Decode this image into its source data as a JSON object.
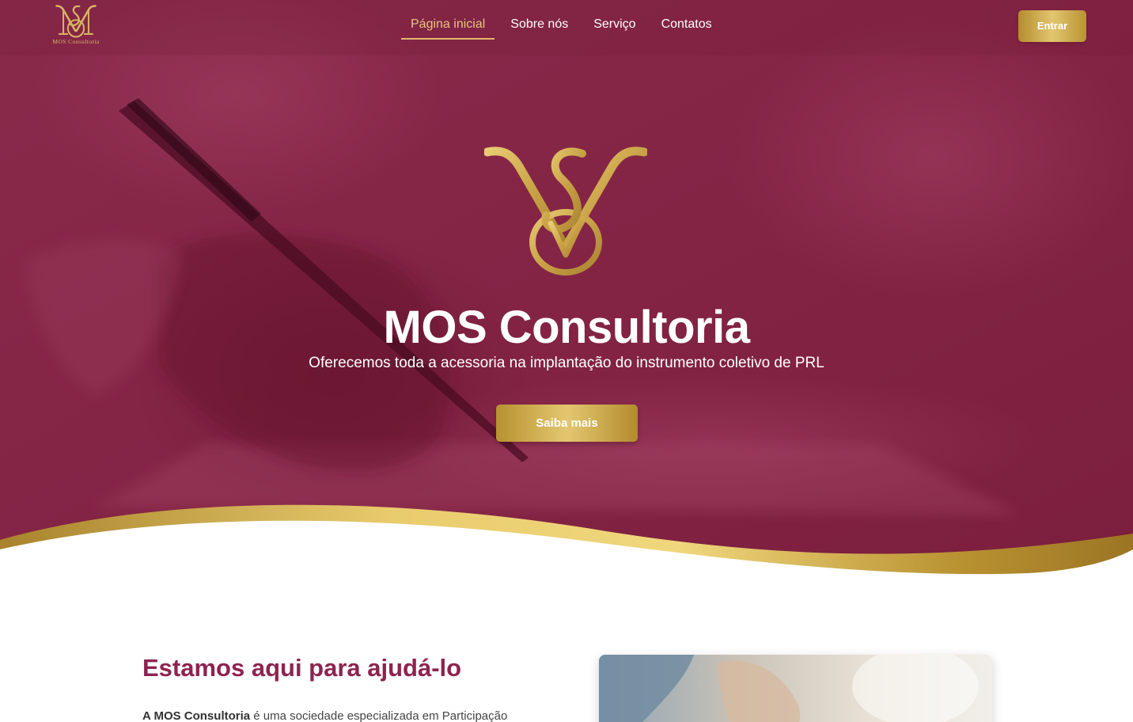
{
  "brand": {
    "logo_text": "MOS Consultoria",
    "gold": "#d4b057",
    "burgundy": "#8a2348"
  },
  "nav": {
    "items": [
      {
        "label": "Página inicial",
        "active": true
      },
      {
        "label": "Sobre nós",
        "active": false
      },
      {
        "label": "Serviço",
        "active": false
      },
      {
        "label": "Contatos",
        "active": false
      }
    ],
    "login_label": "Entrar"
  },
  "hero": {
    "title": "MOS Consultoria",
    "subtitle": "Oferecemos toda a acessoria na implantação do instrumento coletivo de PRL",
    "cta_label": "Saiba mais"
  },
  "about": {
    "title": "Estamos aqui para ajudá-lo",
    "text_bold": "A MOS Consultoria",
    "text_rest": " é uma sociedade especializada em Participação"
  }
}
